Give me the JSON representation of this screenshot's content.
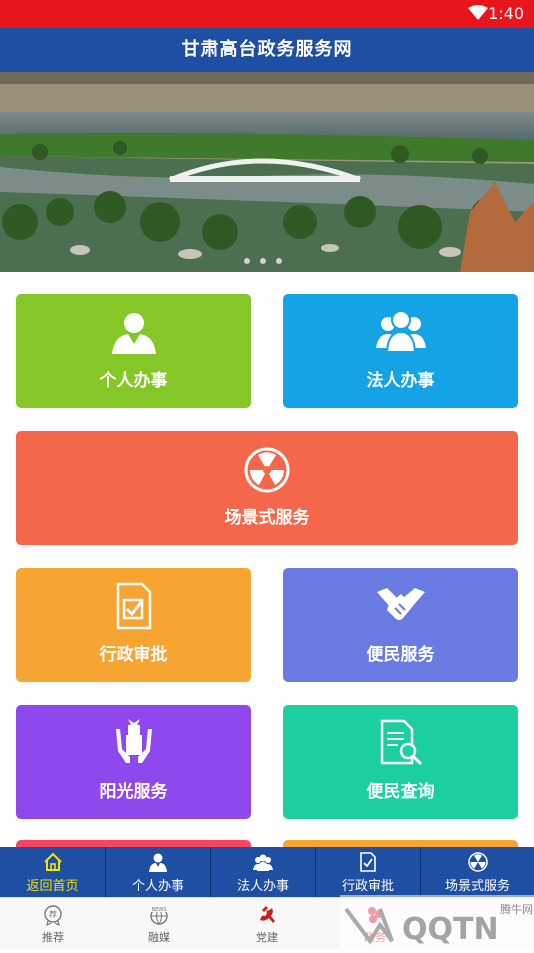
{
  "status_bar": {
    "time": "1:40"
  },
  "header": {
    "title": "甘肃高台政务服务网"
  },
  "tiles": [
    {
      "label": "个人办事",
      "color": "#84c726",
      "icon": "person-icon"
    },
    {
      "label": "法人办事",
      "color": "#14a3e4",
      "icon": "group-icon"
    },
    {
      "label": "场景式服务",
      "color": "#f5674a",
      "icon": "radiation-icon"
    },
    {
      "label": "行政审批",
      "color": "#f7a532",
      "icon": "document-check-icon"
    },
    {
      "label": "便民服务",
      "color": "#6a7ce3",
      "icon": "handshake-icon"
    },
    {
      "label": "阳光服务",
      "color": "#8e48ed",
      "icon": "gift-hands-icon"
    },
    {
      "label": "便民查询",
      "color": "#1bcfa1",
      "icon": "search-document-icon"
    }
  ],
  "nav": {
    "items": [
      {
        "label": "返回首页",
        "icon": "home-icon",
        "active": true
      },
      {
        "label": "个人办事",
        "icon": "person-icon"
      },
      {
        "label": "法人办事",
        "icon": "group-icon"
      },
      {
        "label": "行政审批",
        "icon": "document-check-icon"
      },
      {
        "label": "场景式服务",
        "icon": "radiation-icon"
      }
    ],
    "active_color": "#f5e300"
  },
  "tabs": {
    "items": [
      {
        "label": "推荐",
        "icon": "recommend-icon"
      },
      {
        "label": "融媒",
        "icon": "news-globe-icon"
      },
      {
        "label": "党建",
        "icon": "party-emblem-icon"
      },
      {
        "label": "政务",
        "icon": "gov-service-icon"
      }
    ]
  },
  "watermark": {
    "text": "QQTN",
    "sub": "腾牛网"
  }
}
